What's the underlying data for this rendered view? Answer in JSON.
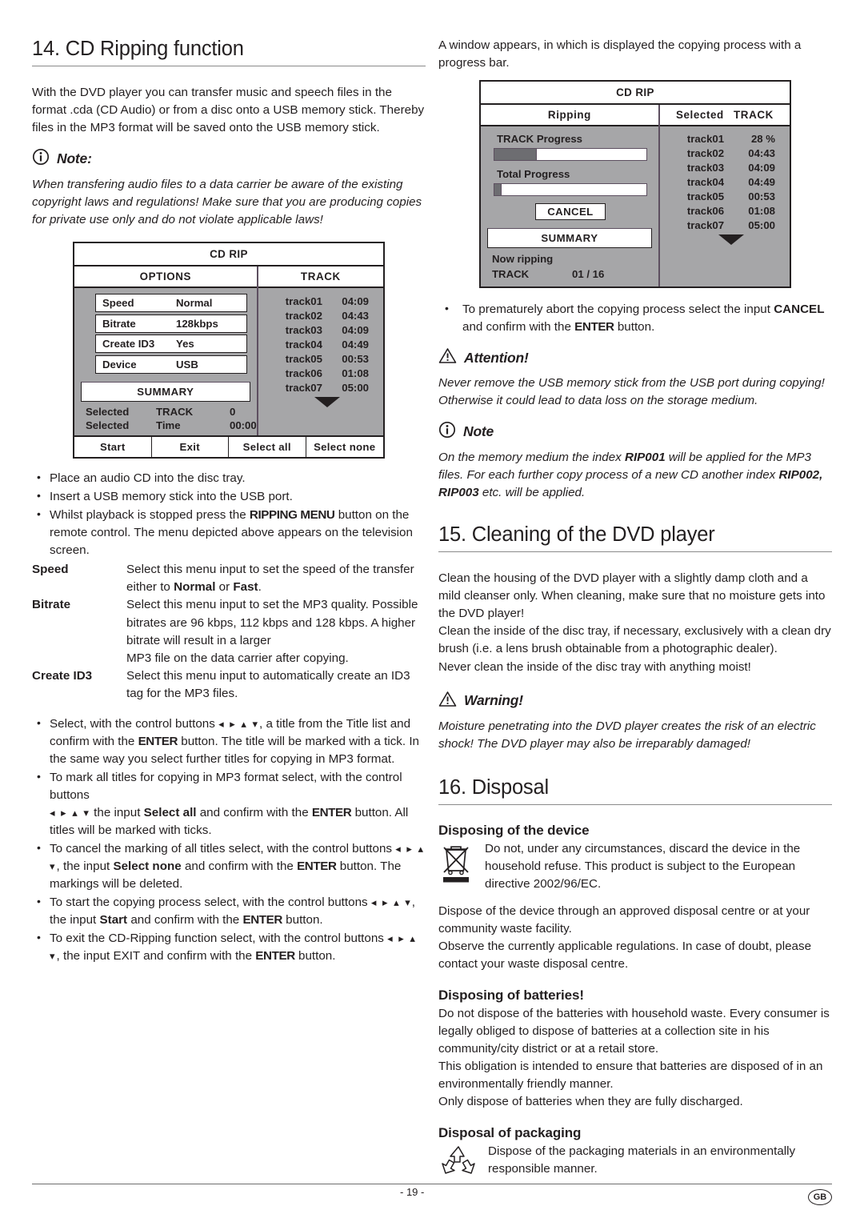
{
  "left": {
    "heading": "14. CD Ripping function",
    "intro": "With the DVD player you can transfer music and speech files in the format .cda (CD Audio) or from a disc onto a USB memory stick. Thereby files in the MP3 format will be saved onto the USB memory stick.",
    "note_label": "Note:",
    "note_text": "When transfering audio files to a data carrier be aware of the existing copyright laws and regulations! Make sure that you are producing copies for private use only and do not violate applicable laws!",
    "steps": [
      "Place an audio CD into the disc tray.",
      "Insert a USB memory stick into the USB port."
    ],
    "step3_a": "Whilst playback is stopped press the ",
    "step3_key": "RIPPING MENU",
    "step3_b": " button on the remote control. The menu depicted above appears on the television screen.",
    "definitions": [
      {
        "term": "Speed",
        "text_a": "Select this menu input to set the speed of the transfer either to ",
        "bold_1": "Normal",
        "text_b": " or ",
        "bold_2": "Fast",
        "text_c": "."
      },
      {
        "term": "Bitrate",
        "text_a": "Select this menu input to set the MP3 quality. Possible bitrates are 96 kbps, 112 kbps and 128 kbps. A higher bitrate will result in a larger",
        "text_b": "MP3 file on the data carrier after copying."
      },
      {
        "term": "Create ID3",
        "text_a": "Select this menu input to automatically create an ID3 tag for the MP3 files."
      }
    ],
    "ops": [
      {
        "p1": "Select, with the control buttons ",
        "arrows": "◂ ▸ ▴ ▾",
        "p2": ", a title from the Title list and confirm with the ",
        "key1": "ENTER",
        "p3": " button. The title will be marked with a tick. In the same way you select further titles for copying in MP3 format."
      },
      {
        "p1": "To mark all titles for copying in MP3 format select, with the control buttons ",
        "arrows": "◂ ▸ ▴ ▾",
        "p2": " the input ",
        "bold1": "Select all",
        "p3": " and confirm with the ",
        "key1": "ENTER",
        "p4": " button. All titles will be marked with ticks."
      },
      {
        "p1": "To cancel the marking of all titles select, with the control buttons ",
        "arrows": "◂ ▸ ▴ ▾",
        "p2": ", the input ",
        "bold1": "Select none",
        "p3": " and confirm with the ",
        "key1": "ENTER",
        "p4": " button. The markings will be deleted."
      },
      {
        "p1": "To start the copying process select, with the control buttons ",
        "arrows": "◂ ▸ ▴ ▾",
        "p2": ", the input ",
        "bold1": "Start",
        "p3": " and confirm with the ",
        "key1": "ENTER",
        "p4": " button."
      },
      {
        "p1": "To exit the CD-Ripping function select, with the control buttons ",
        "arrows": "◂ ▸ ▴ ▾",
        "p2": ", the input EXIT and confirm with the ",
        "key1": "ENTER",
        "p4": " button."
      }
    ]
  },
  "osd_menu": {
    "title": "CD RIP",
    "col_left_head": "OPTIONS",
    "col_right_head": "TRACK",
    "options": [
      {
        "key": "Speed",
        "value": "Normal"
      },
      {
        "key": "Bitrate",
        "value": "128kbps"
      },
      {
        "key": "Create ID3",
        "value": "Yes"
      },
      {
        "key": "Device",
        "value": "USB"
      }
    ],
    "summary_label": "SUMMARY",
    "summary_rows": [
      {
        "a": "Selected",
        "b": "TRACK",
        "c": "0"
      },
      {
        "a": "Selected",
        "b": "Time",
        "c": "00:00"
      }
    ],
    "tracks": [
      {
        "name": "track01",
        "time": "04:09"
      },
      {
        "name": "track02",
        "time": "04:43"
      },
      {
        "name": "track03",
        "time": "04:09"
      },
      {
        "name": "track04",
        "time": "04:49"
      },
      {
        "name": "track05",
        "time": "00:53"
      },
      {
        "name": "track06",
        "time": "01:08"
      },
      {
        "name": "track07",
        "time": "05:00"
      }
    ],
    "scroll_arrow": "▼",
    "buttons": [
      "Start",
      "Exit",
      "Select all",
      "Select none"
    ]
  },
  "right": {
    "intro": "A window appears, in which is displayed the copying process with a progress bar.",
    "cancel_bullet": {
      "p1": "To prematurely abort the copying process select the input ",
      "bold1": "CANCEL",
      "p2": " and confirm with the ",
      "key1": "ENTER",
      "p3": " button."
    },
    "attention_label": "Attention!",
    "attention_text": "Never remove the USB memory stick from the USB port during copying! Otherwise it could lead to data loss on the storage medium.",
    "note_label": "Note",
    "note_a": "On the memory medium the index ",
    "note_b1": "RIP001",
    "note_c": " will be applied for the MP3 files. For each further copy process of a new CD another index ",
    "note_b2": "RIP002, RIP003",
    "note_d": " etc. will be applied.",
    "cleaning_heading": "15. Cleaning of the DVD player",
    "cleaning_p1": "Clean the housing of the DVD player with a slightly damp cloth and a mild cleanser only. When cleaning, make sure that no moisture gets into the DVD player!",
    "cleaning_p2": "Clean the inside of the disc tray, if necessary, exclusively with a clean dry brush (i.e. a lens brush obtainable from a photographic dealer).",
    "cleaning_p3": "Never clean the inside of the disc tray with anything moist!",
    "warning_label": "Warning!",
    "warning_text": "Moisture penetrating into the DVD player creates the risk of an electric shock! The DVD player may also be irreparably damaged!",
    "disposal_heading": "16. Disposal",
    "device_sub": "Disposing of the device",
    "device_icon_text": "Do not, under any circumstances, discard the device in the household refuse. This product is subject to the European directive 2002/96/EC.",
    "device_p1": "Dispose of the device through an approved disposal centre or at your community waste facility.",
    "device_p2": "Observe the currently applicable regulations. In case of doubt, please contact your waste disposal centre.",
    "batteries_sub": "Disposing of batteries!",
    "batteries_p1": "Do not dispose of the batteries with household waste. Every consumer is legally obliged to dispose of batteries at a collection site in his community/city district or at a retail store.",
    "batteries_p2": "This obligation is intended to ensure that batteries are disposed of in an environmentally friendly manner.",
    "batteries_p3": "Only dispose of batteries when they are fully discharged.",
    "packaging_sub": "Disposal of packaging",
    "packaging_text": "Dispose of the packaging materials in an environmentally responsible manner."
  },
  "osd_progress": {
    "title": "CD RIP",
    "col_left_head": "Ripping",
    "col_right_head_a": "Selected",
    "col_right_head_b": "TRACK",
    "track_progress_label": "TRACK Progress",
    "track_progress_percent": 28,
    "total_progress_label": "Total Progress",
    "total_progress_percent": 5,
    "cancel_label": "CANCEL",
    "summary_label": "SUMMARY",
    "now_ripping_label": "Now ripping",
    "now_rows": [
      {
        "a": "TRACK",
        "b": "01 / 16"
      }
    ],
    "tracks": [
      {
        "name": "track01",
        "time": "28 %"
      },
      {
        "name": "track02",
        "time": "04:43"
      },
      {
        "name": "track03",
        "time": "04:09"
      },
      {
        "name": "track04",
        "time": "04:49"
      },
      {
        "name": "track05",
        "time": "00:53"
      },
      {
        "name": "track06",
        "time": "01:08"
      },
      {
        "name": "track07",
        "time": "05:00"
      }
    ],
    "scroll_arrow": "▼"
  },
  "footer": {
    "page_number": "- 19 -",
    "locale": "GB"
  }
}
